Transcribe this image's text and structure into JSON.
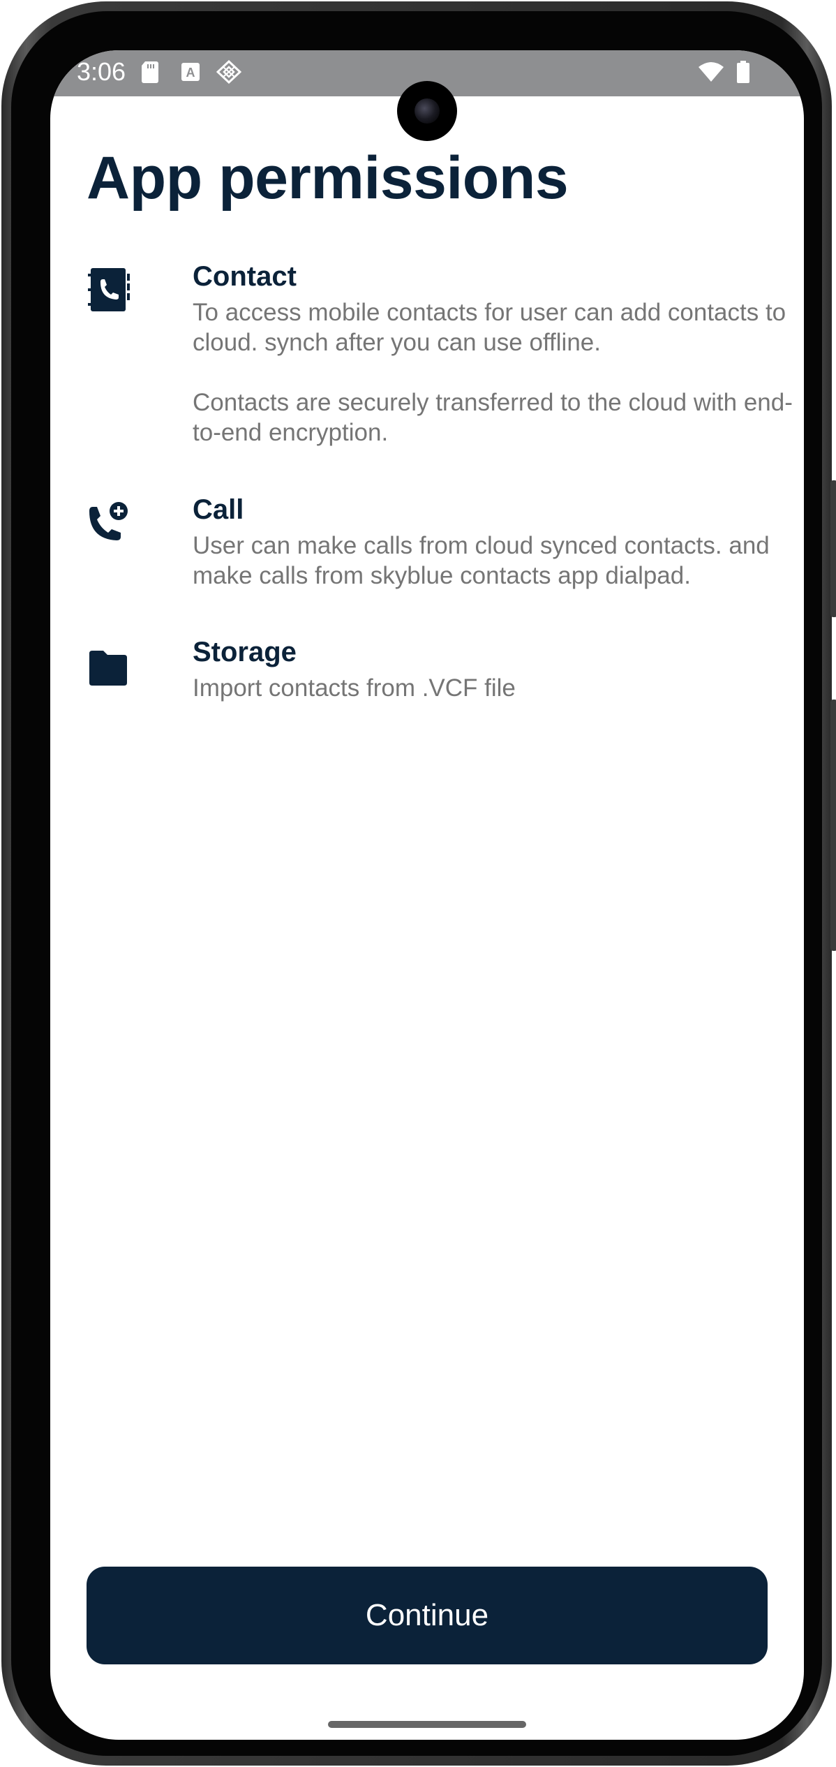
{
  "status_bar": {
    "time": "3:06"
  },
  "page": {
    "title": "App permissions"
  },
  "permissions": [
    {
      "icon": "contact-book-icon",
      "title": "Contact",
      "description": "To access mobile contacts for user can add contacts to cloud. synch after you can use offline.",
      "note": "Contacts are securely transferred to the cloud with end-to-end encryption."
    },
    {
      "icon": "phone-add-icon",
      "title": "Call",
      "description": "User can make calls from cloud synced contacts. and make calls from skyblue contacts app dialpad."
    },
    {
      "icon": "folder-icon",
      "title": "Storage",
      "description": "Import contacts from .VCF file"
    }
  ],
  "actions": {
    "continue_label": "Continue"
  },
  "colors": {
    "primary": "#0b2239",
    "description_text": "#757575",
    "status_bar": "#8e8f91"
  }
}
